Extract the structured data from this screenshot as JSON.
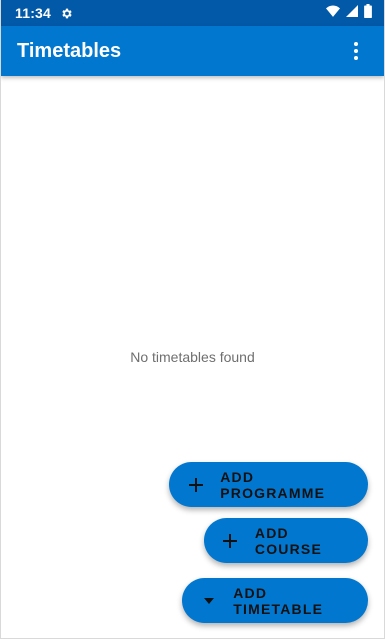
{
  "status_bar": {
    "time": "11:34",
    "icons": [
      "settings-gear-icon",
      "wifi-icon",
      "signal-icon",
      "battery-icon"
    ]
  },
  "app_bar": {
    "title": "Timetables",
    "menu_icon": "more-vert-icon"
  },
  "content": {
    "empty_message": "No timetables found"
  },
  "fab_menu": {
    "items": [
      {
        "label": "ADD PROGRAMME",
        "icon": "plus-icon"
      },
      {
        "label": "ADD COURSE",
        "icon": "plus-icon"
      },
      {
        "label": "ADD TIMETABLE",
        "icon": "caret-down-icon"
      }
    ]
  },
  "colors": {
    "status_bar": "#0259a8",
    "app_bar": "#0277cf",
    "fab": "#0277cf",
    "empty_text": "#6f6f6f"
  }
}
